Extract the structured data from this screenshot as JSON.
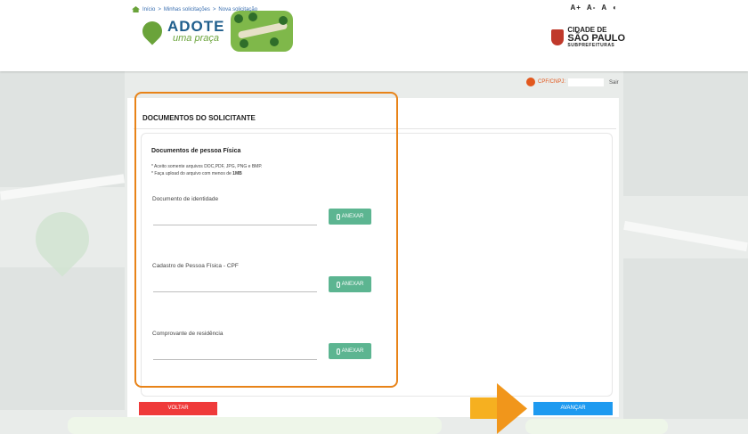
{
  "header": {
    "a11y": [
      "A+",
      "A-",
      "A",
      "◐"
    ],
    "logo_title": "ADOTE",
    "logo_subtitle": "uma praça",
    "city_line1": "CIDADE DE",
    "city_line2": "SÃO PAULO",
    "city_line3": "SUBPREFEITURAS"
  },
  "breadcrumb": {
    "home": "Início",
    "sep": ">",
    "item1": "Minhas solicitações",
    "item2": "Nova solicitação"
  },
  "user": {
    "cpf_label": "CPF/CNPJ:",
    "cpf_value": "",
    "logout": "Sair"
  },
  "section": {
    "title": "DOCUMENTOS DO SOLICITANTE",
    "subtitle": "Documentos de pessoa Física",
    "note1": "* Aceito somente arquivos DOC,PDF, JPG, PNG e BMP.",
    "note2_prefix": "* Faça upload do arquivo com menos de ",
    "note2_bold": "1MB"
  },
  "fields": [
    {
      "label": "Documento de identidade",
      "button": "ANEXAR"
    },
    {
      "label": "Cadastro de Pessoa Física - CPF",
      "button": "ANEXAR"
    },
    {
      "label": "Comprovante de residência",
      "button": "ANEXAR"
    }
  ],
  "footer": {
    "back": "VOLTAR",
    "next": "AVANÇAR"
  },
  "colors": {
    "accent_green": "#5cb591",
    "back_red": "#ef3a3a",
    "next_blue": "#1e9af0",
    "highlight_orange": "#e88318"
  }
}
